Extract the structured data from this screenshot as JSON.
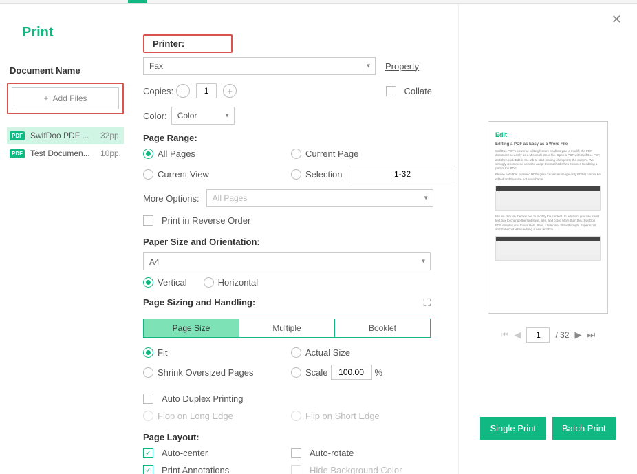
{
  "title": "Print",
  "sidebar": {
    "docname_label": "Document Name",
    "addfiles_label": "Add Files",
    "files": [
      {
        "name": "SwifDoo PDF ...",
        "pages": "32pp."
      },
      {
        "name": "Test Documen...",
        "pages": "10pp."
      }
    ]
  },
  "printer": {
    "label": "Printer:",
    "value": "Fax",
    "property_link": "Property"
  },
  "copies": {
    "label": "Copies:",
    "value": "1"
  },
  "collate_label": "Collate",
  "color": {
    "label": "Color:",
    "value": "Color"
  },
  "page_range": {
    "heading": "Page Range:",
    "all": "All Pages",
    "current": "Current Page",
    "view": "Current View",
    "selection": "Selection",
    "range_value": "1-32"
  },
  "more_options": {
    "label": "More Options:",
    "value": "All Pages"
  },
  "reverse_label": "Print in Reverse Order",
  "paper": {
    "heading": "Paper Size and Orientation:",
    "size": "A4",
    "vertical": "Vertical",
    "horizontal": "Horizontal"
  },
  "sizing": {
    "heading": "Page Sizing and Handling:",
    "tabs": {
      "size": "Page Size",
      "multiple": "Multiple",
      "booklet": "Booklet"
    },
    "fit": "Fit",
    "actual": "Actual Size",
    "shrink": "Shrink Oversized Pages",
    "scale": "Scale",
    "scale_value": "100.00",
    "percent": "%"
  },
  "duplex": {
    "auto": "Auto Duplex Printing",
    "long": "Flop on Long Edge",
    "short": "Flip on Short Edge"
  },
  "layout": {
    "heading": "Page Layout:",
    "center": "Auto-center",
    "rotate": "Auto-rotate",
    "annotations": "Print Annotations",
    "hidebg": "Hide Background Color"
  },
  "preview": {
    "title": "Edit",
    "subtitle": "Editing a PDF as Easy as a Word File",
    "para1": "SwifDoo PDF's powerful editing feature enables you to modify the PDF document as easily as a Microsoft Word file. Open a PDF with SwifDoo PDF, and then click Edit in the tab to start making changes to the content. We strongly recommend users to adapt this method when it comes to editing a part of the PDF.",
    "para2": "Please note that scanned PDFs (also known as image-only PDFs) cannot be edited and thus are not searchable.",
    "para3": "Mouse click on the text box to modify the content. In addition, you can insert text box to change the font style, size, and color. More than this, SwifDoo PDF enables you to use Bold, Italic, Underline, Strikethrough, Superscript, and Subscript when editing a new text box."
  },
  "pager": {
    "current": "1",
    "total": "/ 32"
  },
  "actions": {
    "single": "Single Print",
    "batch": "Batch Print"
  }
}
